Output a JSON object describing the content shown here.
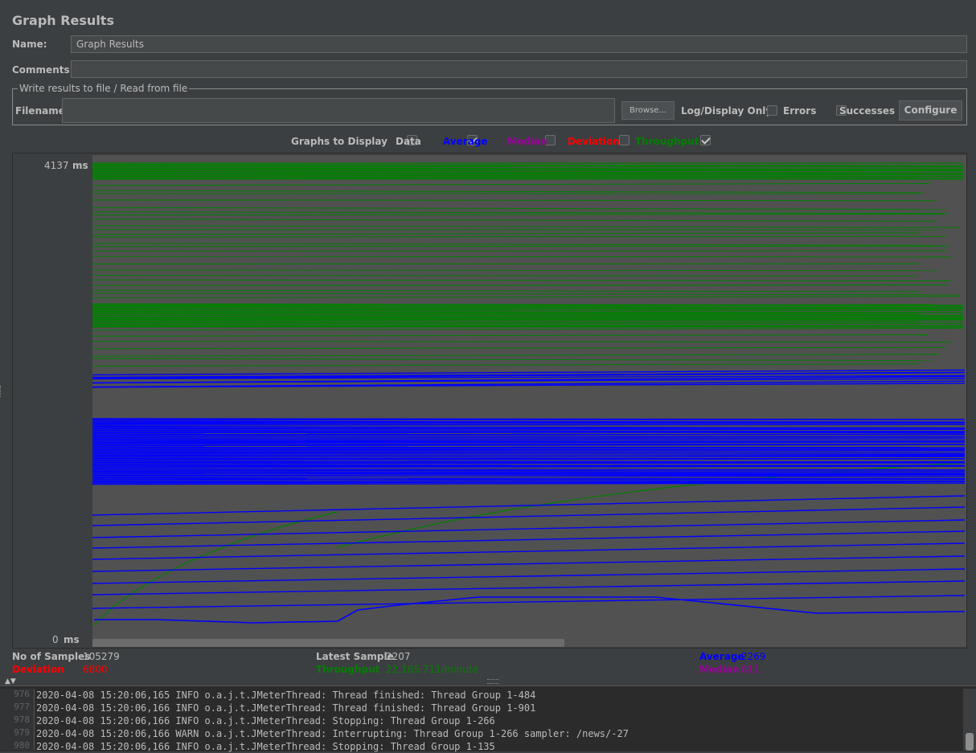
{
  "title": "Graph Results",
  "name_label": "Name:",
  "name_value": "Graph Results",
  "comments_label": "Comments:",
  "comments_value": "",
  "file_section_legend": "Write results to file / Read from file",
  "filename_label": "Filename",
  "filename_value": "",
  "browse_label": "Browse...",
  "log_display_label": "Log/Display Only:",
  "errors_label": "Errors",
  "errors_checked": false,
  "successes_label": "Successes",
  "successes_checked": false,
  "configure_label": "Configure",
  "graphs_to_display_label": "Graphs to Display",
  "toggles": [
    {
      "label": "Data",
      "checked": false,
      "color": "#bbbbbb"
    },
    {
      "label": "Average",
      "checked": true,
      "color": "#0000ff"
    },
    {
      "label": "Median",
      "checked": false,
      "color": "#9b009b"
    },
    {
      "label": "Deviation",
      "checked": false,
      "color": "#ff0000"
    },
    {
      "label": "Throughput",
      "checked": true,
      "color": "#008000"
    }
  ],
  "y_axis": {
    "max_label": "4137",
    "min_label": "0",
    "unit": "ms"
  },
  "stats": {
    "samples_label": "No of Samples",
    "samples_value": "105279",
    "latest_label": "Latest Sample",
    "latest_value": "2207",
    "average_label": "Average",
    "average_value": "2269",
    "deviation_label": "Deviation",
    "deviation_value": "6800",
    "throughput_label": "Throughput",
    "throughput_value": "22,165.711/minute",
    "median_label": "Median",
    "median_value": "811"
  },
  "log": [
    {
      "line": "976",
      "text": "2020-04-08 15:20:06,165 INFO o.a.j.t.JMeterThread: Thread finished: Thread Group 1-484"
    },
    {
      "line": "977",
      "text": "2020-04-08 15:20:06,166 INFO o.a.j.t.JMeterThread: Thread finished: Thread Group 1-901"
    },
    {
      "line": "978",
      "text": "2020-04-08 15:20:06,166 INFO o.a.j.t.JMeterThread: Stopping: Thread Group 1-266"
    },
    {
      "line": "979",
      "text": "2020-04-08 15:20:06,166 WARN o.a.j.t.JMeterThread: Interrupting: Thread Group 1-266 sampler: /news/-27"
    },
    {
      "line": "980",
      "text": "2020-04-08 15:20:06,166 INFO o.a.j.t.JMeterThread: Stopping: Thread Group 1-135"
    }
  ],
  "colors": {
    "average": "#0000ff",
    "throughput": "#008000",
    "deviation": "#ff0000",
    "median": "#9b009b",
    "plot_bg": "#515151"
  }
}
